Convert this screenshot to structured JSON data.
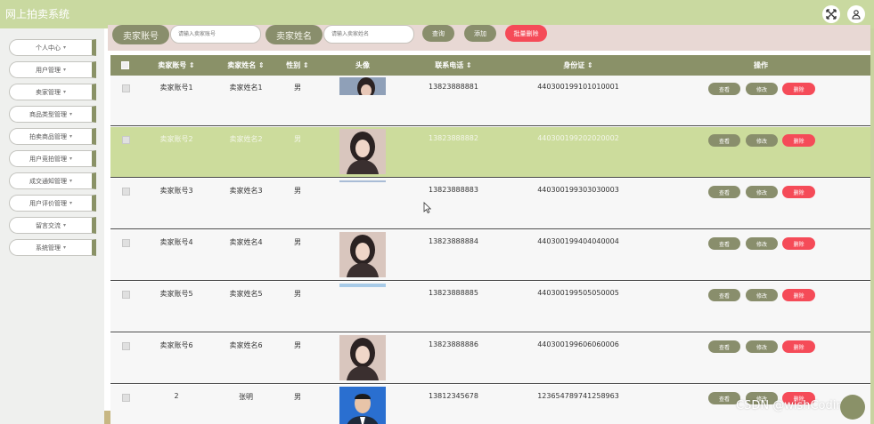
{
  "app": {
    "title": "网上拍卖系统"
  },
  "header_icons": [
    {
      "name": "fullscreen-icon"
    },
    {
      "name": "user-icon"
    }
  ],
  "sidebar": {
    "items": [
      {
        "label": "个人中心"
      },
      {
        "label": "用户管理"
      },
      {
        "label": "卖家管理"
      },
      {
        "label": "商品类型管理"
      },
      {
        "label": "拍卖商品管理"
      },
      {
        "label": "用户竞拍管理"
      },
      {
        "label": "成交通知管理"
      },
      {
        "label": "用户评价管理"
      },
      {
        "label": "留言交流"
      },
      {
        "label": "系统管理"
      }
    ]
  },
  "search": {
    "account_label": "卖家账号",
    "account_placeholder": "请输入卖家账号",
    "name_label": "卖家姓名",
    "name_placeholder": "请输入卖家姓名",
    "query_button": "查询",
    "add_button": "添加",
    "batch_delete_button": "批量删除"
  },
  "table": {
    "columns": [
      "卖家账号",
      "卖家姓名",
      "性别",
      "头像",
      "联系电话",
      "身份证",
      "操作"
    ],
    "rows": [
      {
        "account": "卖家账号1",
        "name": "卖家姓名1",
        "gender": "男",
        "phone": "13823888881",
        "id_card": "440300199101010001"
      },
      {
        "account": "卖家账号2",
        "name": "卖家姓名2",
        "gender": "男",
        "phone": "13823888882",
        "id_card": "440300199202020002"
      },
      {
        "account": "卖家账号3",
        "name": "卖家姓名3",
        "gender": "男",
        "phone": "13823888883",
        "id_card": "440300199303030003"
      },
      {
        "account": "卖家账号4",
        "name": "卖家姓名4",
        "gender": "男",
        "phone": "13823888884",
        "id_card": "440300199404040004"
      },
      {
        "account": "卖家账号5",
        "name": "卖家姓名5",
        "gender": "男",
        "phone": "13823888885",
        "id_card": "440300199505050005"
      },
      {
        "account": "卖家账号6",
        "name": "卖家姓名6",
        "gender": "男",
        "phone": "13823888886",
        "id_card": "440300199606060006"
      },
      {
        "account": "2",
        "name": "张明",
        "gender": "男",
        "phone": "13812345678",
        "id_card": "123654789741258963"
      }
    ],
    "actions": {
      "view": "查看",
      "edit": "修改",
      "delete": "删除"
    },
    "selected_row": 2
  },
  "watermark": "CSDN @wishCoding",
  "colors": {
    "topbar": "#c9d9a0",
    "accent": "#898e6c",
    "danger": "#f54b58",
    "selected_row": "#ccdc9c"
  }
}
